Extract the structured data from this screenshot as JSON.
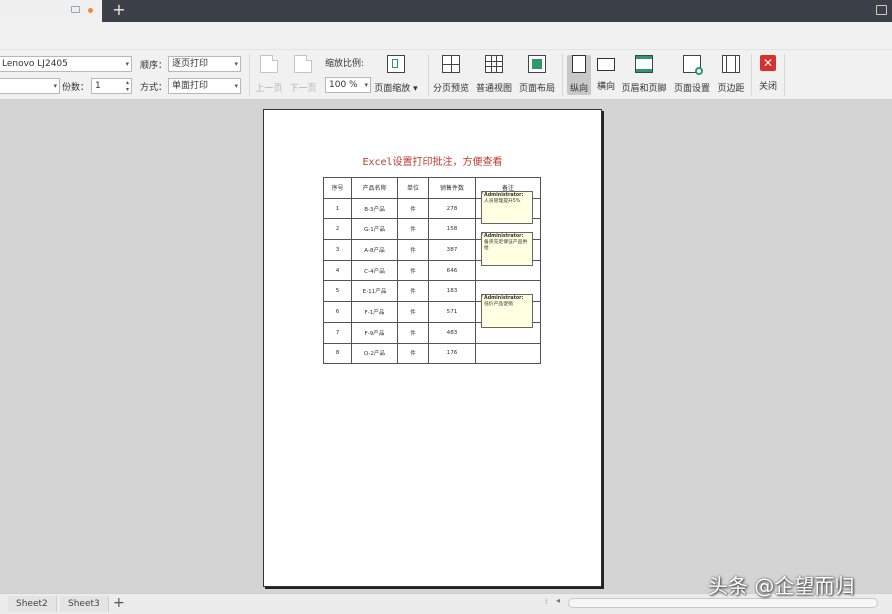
{
  "toolbar": {
    "printer_value": "Lenovo LJ2405",
    "order_label": "顺序：",
    "order_value": "逐页打印",
    "copies_label": "份数：",
    "copies_value": "1",
    "mode_label": "方式：",
    "mode_value": "单面打印",
    "prev_page": "上一页",
    "next_page": "下一页",
    "zoom_label": "缩放比例:",
    "zoom_value": "100 %",
    "page_zoom": "页面缩放",
    "page_break_preview": "分页预览",
    "normal_view": "普通视图",
    "page_layout": "页面布局",
    "portrait": "纵向",
    "landscape": "横向",
    "header_footer": "页眉和页脚",
    "page_setup": "页面设置",
    "margins": "页边距",
    "close": "关闭"
  },
  "page": {
    "title": "Excel设置打印批注，方便查看",
    "table": {
      "headers": [
        "序号",
        "产品名称",
        "单位",
        "销售件数",
        "备注"
      ],
      "rows": [
        [
          "1",
          "B-3产品",
          "件",
          "278",
          ""
        ],
        [
          "2",
          "G-1产品",
          "件",
          "158",
          ""
        ],
        [
          "3",
          "A-8产品",
          "件",
          "387",
          ""
        ],
        [
          "4",
          "C-4产品",
          "件",
          "646",
          ""
        ],
        [
          "5",
          "E-11产品",
          "件",
          "183",
          ""
        ],
        [
          "6",
          "F-1产品",
          "件",
          "571",
          ""
        ],
        [
          "7",
          "F-9产品",
          "件",
          "483",
          ""
        ],
        [
          "8",
          "Q-2产品",
          "件",
          "176",
          ""
        ]
      ]
    },
    "notes": [
      {
        "author": "Administrator:",
        "text": "人员管理提升5%"
      },
      {
        "author": "Administrator:",
        "text": "备货充足保证产品供给"
      },
      {
        "author": "Administrator:",
        "text": "低价产品促销"
      }
    ]
  },
  "sheets": [
    "Sheet2",
    "Sheet3"
  ],
  "watermark": "头条 @企望而归",
  "colors": {
    "title_red": "#c0392b",
    "close_red": "#d9302c",
    "tab_dark": "#3c4049",
    "note_bg": "#ffffe1"
  }
}
